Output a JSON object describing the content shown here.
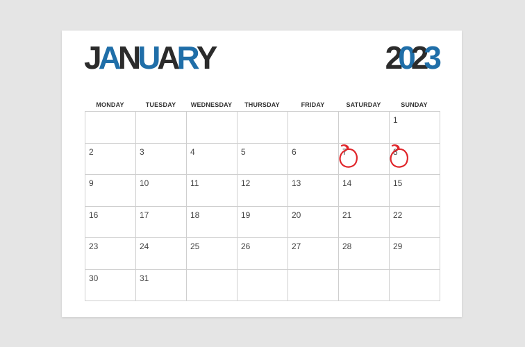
{
  "calendar": {
    "month_letters": [
      {
        "ch": "J",
        "color": "#2b2b2b"
      },
      {
        "ch": "A",
        "color": "#1f6ea8"
      },
      {
        "ch": "N",
        "color": "#2b2b2b"
      },
      {
        "ch": "U",
        "color": "#1f6ea8"
      },
      {
        "ch": "A",
        "color": "#2b2b2b"
      },
      {
        "ch": "R",
        "color": "#1f6ea8"
      },
      {
        "ch": "Y",
        "color": "#2b2b2b"
      }
    ],
    "year_digits": [
      {
        "ch": "2",
        "color": "#2b2b2b"
      },
      {
        "ch": "0",
        "color": "#1f6ea8"
      },
      {
        "ch": "2",
        "color": "#2b2b2b"
      },
      {
        "ch": "3",
        "color": "#1f6ea8"
      }
    ],
    "weekdays": [
      "MONDAY",
      "TUESDAY",
      "WEDNESDAY",
      "THURSDAY",
      "FRIDAY",
      "SATURDAY",
      "SUNDAY"
    ],
    "weeks": [
      [
        "",
        "",
        "",
        "",
        "",
        "",
        "1"
      ],
      [
        "2",
        "3",
        "4",
        "5",
        "6",
        "7",
        "8"
      ],
      [
        "9",
        "10",
        "11",
        "12",
        "13",
        "14",
        "15"
      ],
      [
        "16",
        "17",
        "18",
        "19",
        "20",
        "21",
        "22"
      ],
      [
        "23",
        "24",
        "25",
        "26",
        "27",
        "28",
        "29"
      ],
      [
        "30",
        "31",
        "",
        "",
        "",
        "",
        ""
      ]
    ],
    "circled_days": [
      "7",
      "8"
    ],
    "circle_color": "#e0262b"
  }
}
